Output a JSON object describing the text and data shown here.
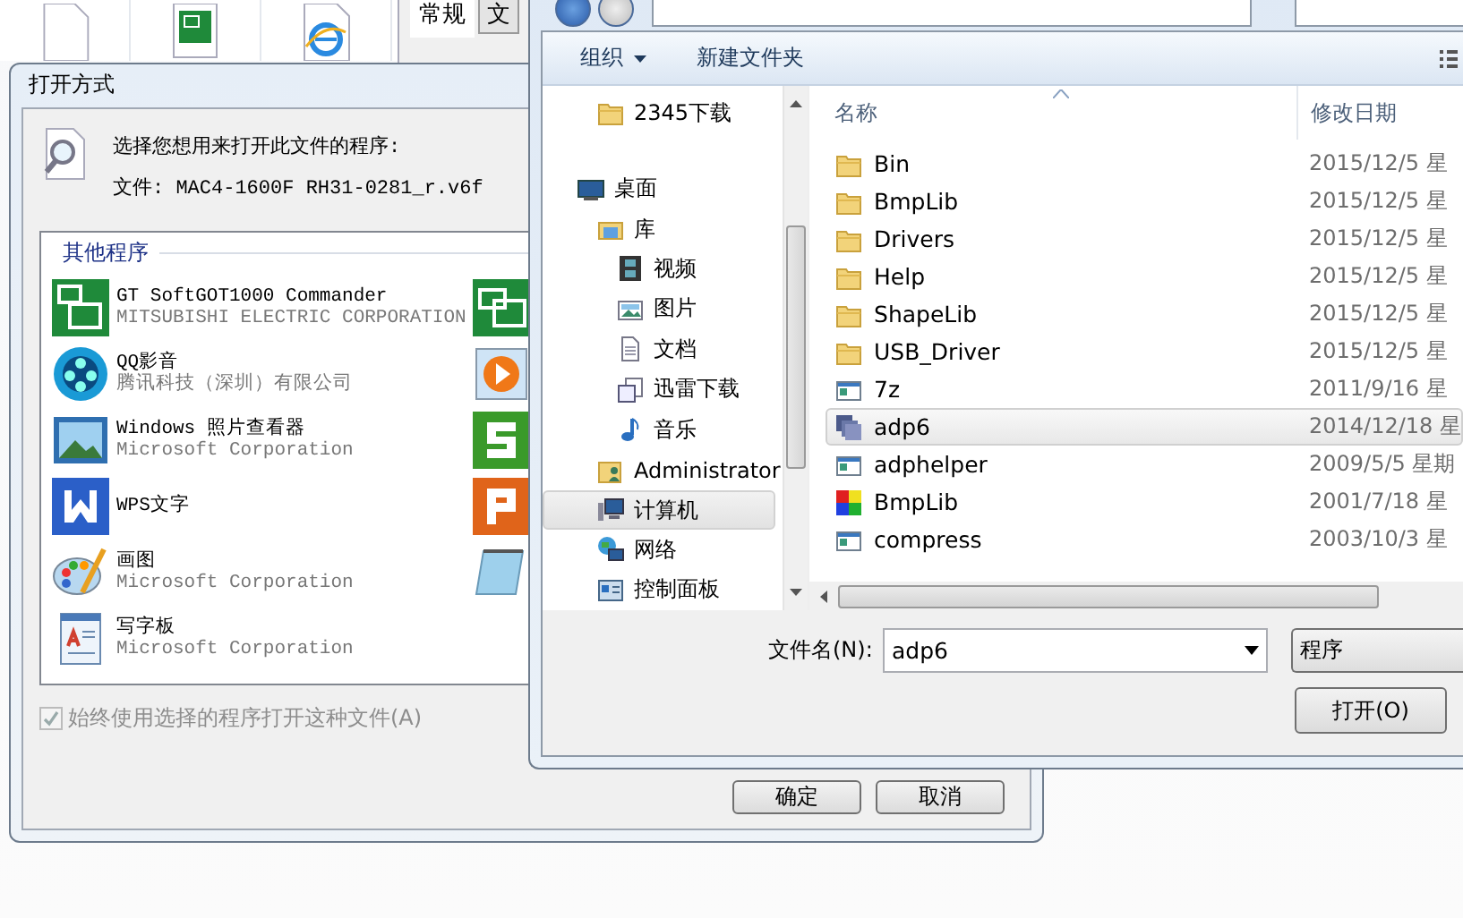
{
  "properties_window": {
    "tabs": [
      {
        "label": "常规",
        "selected": true
      },
      {
        "label": "文",
        "selected": false
      }
    ]
  },
  "open_with_dialog": {
    "title": "打开方式",
    "prompt": "选择您想用来打开此文件的程序:",
    "file_label": "文件:",
    "file_name": "MAC4-1600F RH31-0281_r.v6f",
    "group_label": "其他程序",
    "programs": [
      {
        "name": "GT SoftGOT1000 Commander",
        "publisher": "MITSUBISHI ELECTRIC CORPORATION"
      },
      {
        "name": "QQ影音",
        "publisher": "腾讯科技（深圳）有限公司"
      },
      {
        "name": "Windows 照片查看器",
        "publisher": "Microsoft Corporation"
      },
      {
        "name": "WPS文字"
      },
      {
        "name": "画图",
        "publisher": "Microsoft Corporation"
      },
      {
        "name": "写字板",
        "publisher": "Microsoft Corporation"
      }
    ],
    "always_use": {
      "label": "始终使用选择的程序打开这种文件(A)",
      "checked": true,
      "disabled": true
    },
    "buttons": [
      "确定",
      "取消"
    ]
  },
  "file_dialog": {
    "toolbar": {
      "organize": "组织",
      "new_folder": "新建文件夹"
    },
    "nav": [
      {
        "label": "2345下载",
        "kind": "folder",
        "selected": false
      },
      {
        "label": "桌面",
        "kind": "desktop",
        "selected": false,
        "children": [
          {
            "label": "库",
            "kind": "library",
            "selected": false,
            "children": [
              {
                "label": "视频",
                "kind": "video",
                "selected": false
              },
              {
                "label": "图片",
                "kind": "picture",
                "selected": false
              },
              {
                "label": "文档",
                "kind": "document",
                "selected": false
              },
              {
                "label": "迅雷下载",
                "kind": "download",
                "selected": false
              },
              {
                "label": "音乐",
                "kind": "music",
                "selected": false
              }
            ]
          },
          {
            "label": "Administrator",
            "kind": "user",
            "selected": false
          },
          {
            "label": "计算机",
            "kind": "computer",
            "selected": true
          },
          {
            "label": "网络",
            "kind": "network",
            "selected": false
          },
          {
            "label": "控制面板",
            "kind": "control",
            "selected": false
          }
        ]
      }
    ],
    "columns": [
      "名称",
      "修改日期"
    ],
    "files": [
      {
        "name": "Bin",
        "date": "2015/12/5 星",
        "kind": "folder",
        "selected": false
      },
      {
        "name": "BmpLib",
        "date": "2015/12/5 星",
        "kind": "folder",
        "selected": false
      },
      {
        "name": "Drivers",
        "date": "2015/12/5 星",
        "kind": "folder",
        "selected": false
      },
      {
        "name": "Help",
        "date": "2015/12/5 星",
        "kind": "folder",
        "selected": false
      },
      {
        "name": "ShapeLib",
        "date": "2015/12/5 星",
        "kind": "folder",
        "selected": false
      },
      {
        "name": "USB_Driver",
        "date": "2015/12/5 星",
        "kind": "folder",
        "selected": false
      },
      {
        "name": "7z",
        "date": "2011/9/16 星",
        "kind": "program",
        "selected": false
      },
      {
        "name": "adp6",
        "date": "2014/12/18 星",
        "kind": "adp",
        "selected": true
      },
      {
        "name": "adphelper",
        "date": "2009/5/5 星期",
        "kind": "program",
        "selected": false
      },
      {
        "name": "BmpLib",
        "date": "2001/7/18 星",
        "kind": "bitmap",
        "selected": false
      },
      {
        "name": "compress",
        "date": "2003/10/3 星",
        "kind": "program",
        "selected": false
      }
    ],
    "file_name_label": "文件名(N):",
    "file_name": "adp6",
    "filter": "程序",
    "open_button": "打开(O)"
  }
}
